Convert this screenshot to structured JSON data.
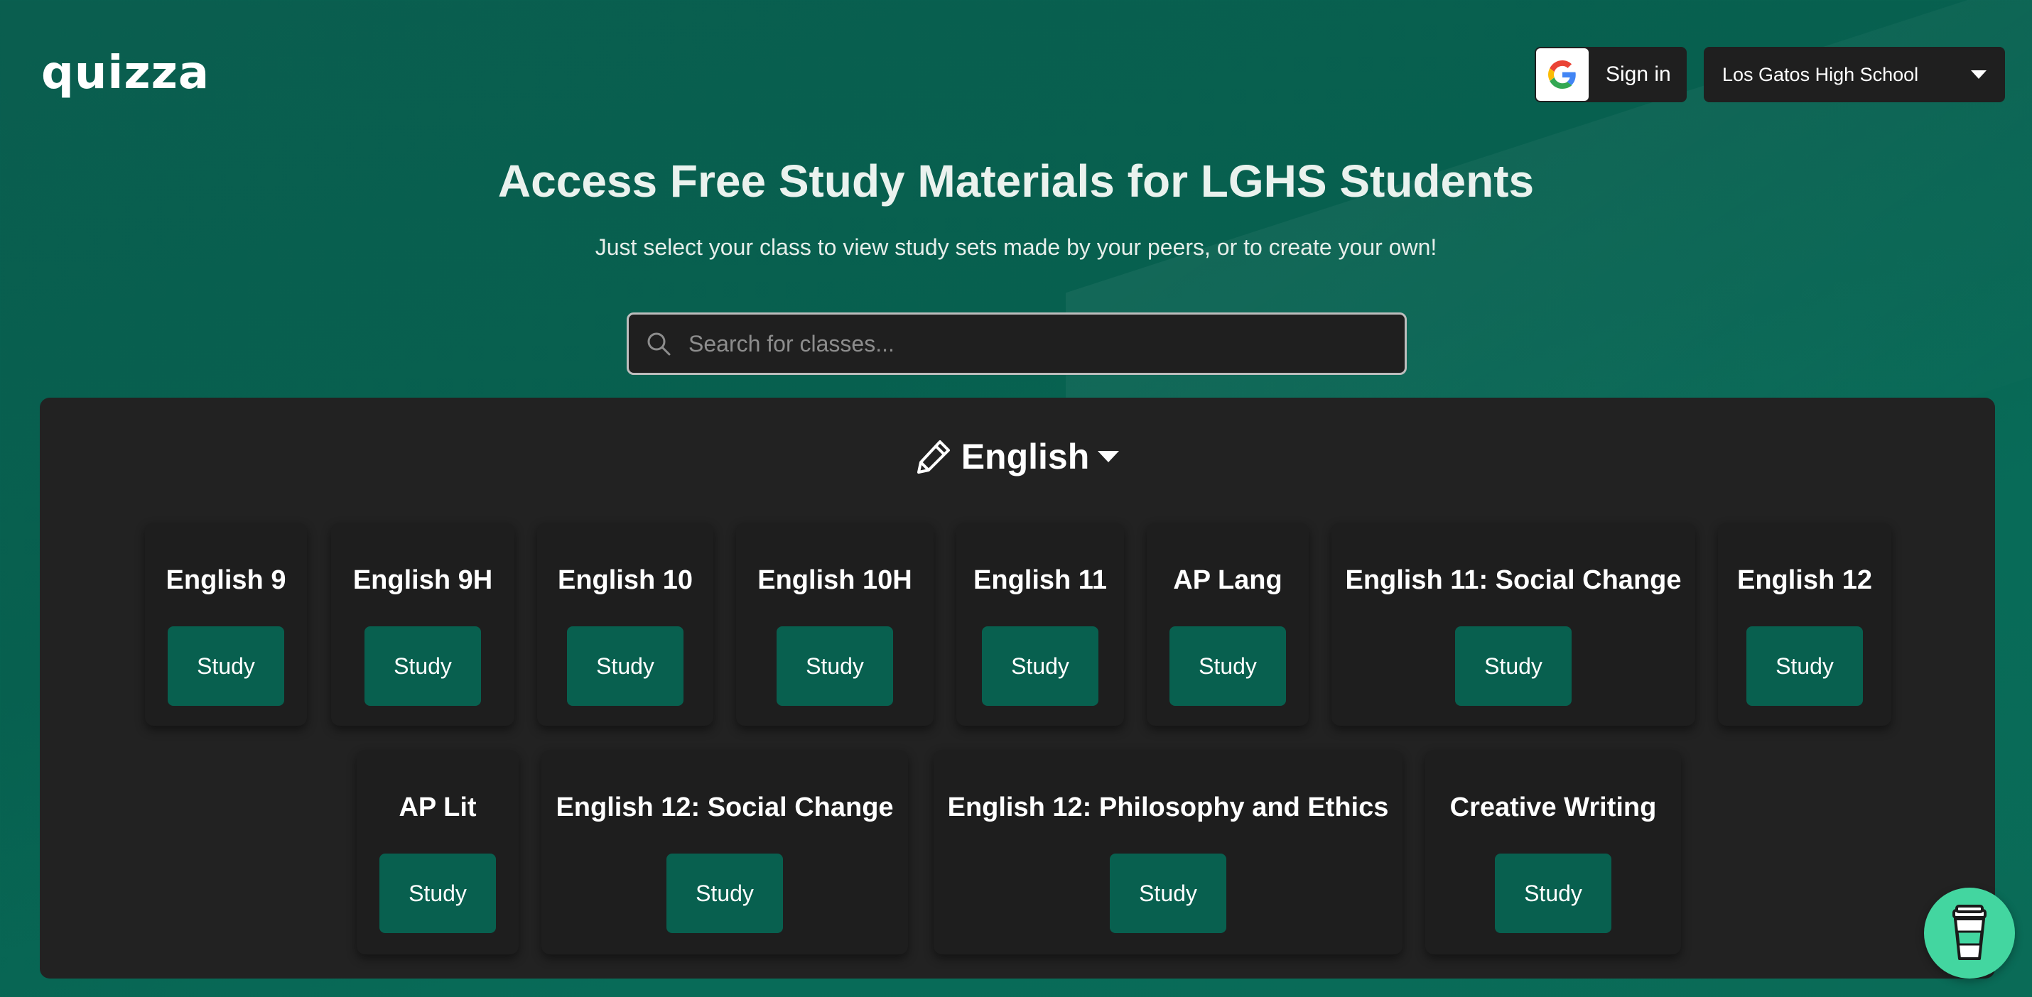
{
  "brand": {
    "logo_text": "quizza"
  },
  "header": {
    "signin_label": "Sign in",
    "school_selected": "Los Gatos High School"
  },
  "hero": {
    "title": "Access Free Study Materials for LGHS Students",
    "subtitle": "Just select your class to view study sets made by your peers, or to create your own!"
  },
  "search": {
    "placeholder": "Search for classes...",
    "value": ""
  },
  "subject": {
    "name": "English",
    "icon": "pencil-icon",
    "classes": [
      {
        "name": "English 9",
        "button": "Study"
      },
      {
        "name": "English 9H",
        "button": "Study"
      },
      {
        "name": "English 10",
        "button": "Study"
      },
      {
        "name": "English 10H",
        "button": "Study"
      },
      {
        "name": "English 11",
        "button": "Study"
      },
      {
        "name": "AP Lang",
        "button": "Study"
      },
      {
        "name": "English 11: Social Change",
        "button": "Study"
      },
      {
        "name": "English 12",
        "button": "Study"
      },
      {
        "name": "AP Lit",
        "button": "Study"
      },
      {
        "name": "English 12: Social Change",
        "button": "Study"
      },
      {
        "name": "English 12: Philosophy and Ethics",
        "button": "Study"
      },
      {
        "name": "Creative Writing",
        "button": "Study"
      }
    ]
  },
  "fab": {
    "icon": "coffee-cup-icon"
  },
  "colors": {
    "background": "#07604f",
    "panel": "#222222",
    "card": "#1e1e1e",
    "button": "#08604f",
    "fab": "#43d6a0"
  }
}
